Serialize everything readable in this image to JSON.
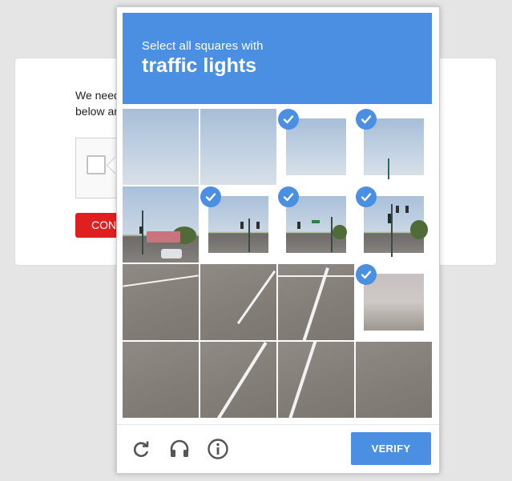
{
  "background_page": {
    "text_line1": "We need",
    "text_line2": "below an",
    "button_label": "CON"
  },
  "challenge": {
    "instruction": "Select all squares with",
    "target": "traffic lights",
    "selected_tiles": [
      2,
      3,
      5,
      6,
      7,
      11
    ],
    "colors": {
      "header": "#4a8fe2",
      "check": "#4a8fe2"
    }
  },
  "footer": {
    "reload_icon": "reload-icon",
    "audio_icon": "headphones-icon",
    "info_icon": "info-icon",
    "verify_label": "VERIFY"
  }
}
